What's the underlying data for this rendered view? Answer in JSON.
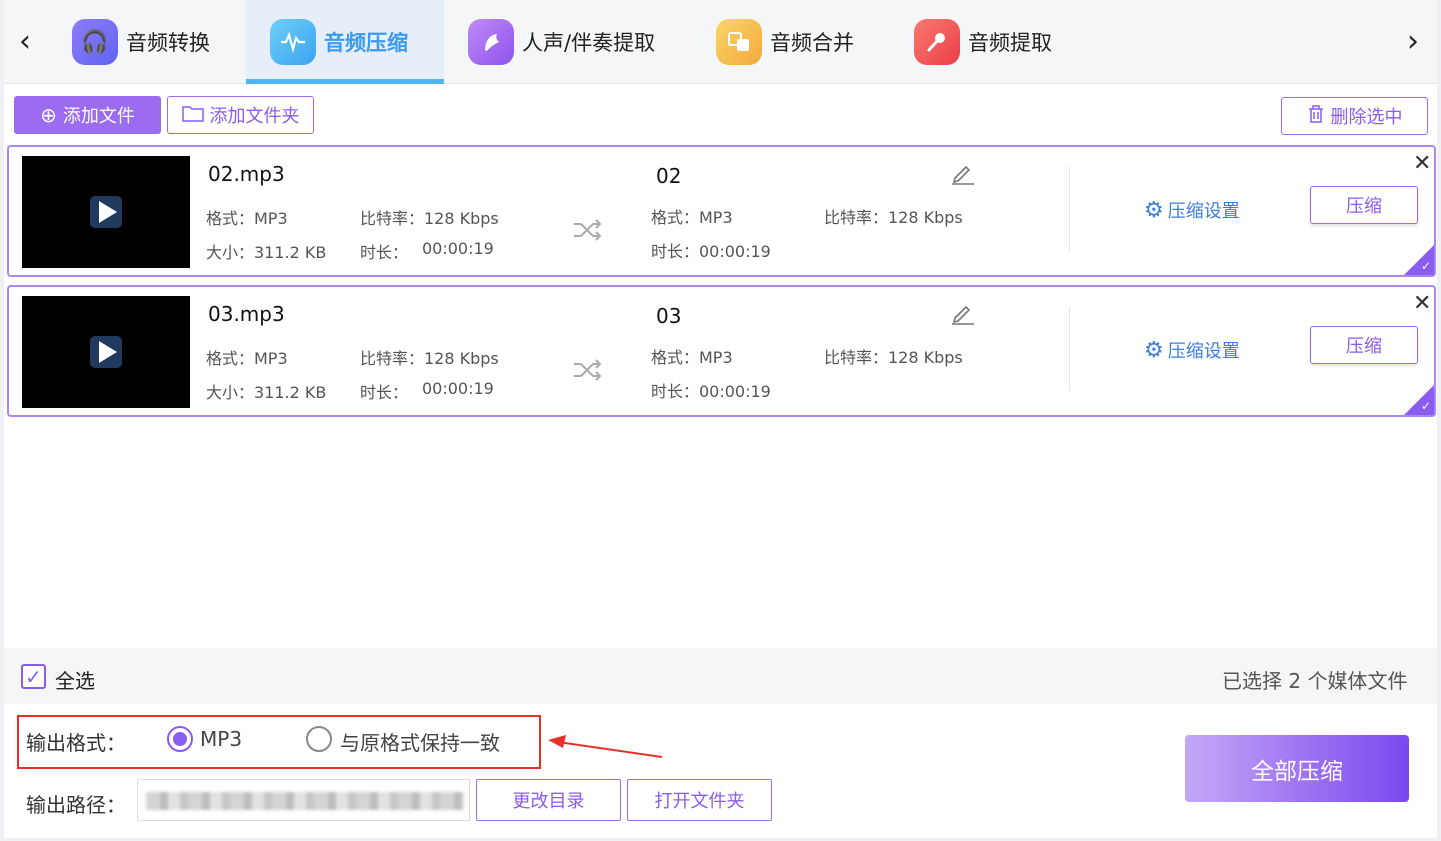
{
  "tabs": [
    {
      "label": "音频转换",
      "icon": "headphones-icon",
      "color": "#7b6cf6"
    },
    {
      "label": "音频压缩",
      "icon": "waveform-icon",
      "color": "#4eb5f4"
    },
    {
      "label": "人声/伴奏提取",
      "icon": "voice-icon",
      "color": "#a86cf2"
    },
    {
      "label": "音频合并",
      "icon": "merge-icon",
      "color": "#f5b740"
    },
    {
      "label": "音频提取",
      "icon": "microphone-icon",
      "color": "#f0484e"
    }
  ],
  "toolbar": {
    "add_file": "添加文件",
    "add_folder": "添加文件夹",
    "delete_selected": "删除选中"
  },
  "files": [
    {
      "name": "02.mp3",
      "format": "格式：MP3",
      "bitrate": "比特率：128 Kbps",
      "size": "大小：311.2 KB",
      "duration_label": "时长：",
      "duration": "00:00:19",
      "out_name": "02",
      "out_format": "格式：MP3",
      "out_bitrate": "比特率：128 Kbps",
      "out_duration": "时长：00:00:19",
      "settings": "压缩设置",
      "compress": "压缩"
    },
    {
      "name": "03.mp3",
      "format": "格式：MP3",
      "bitrate": "比特率：128 Kbps",
      "size": "大小：311.2 KB",
      "duration_label": "时长：",
      "duration": "00:00:19",
      "out_name": "03",
      "out_format": "格式：MP3",
      "out_bitrate": "比特率：128 Kbps",
      "out_duration": "时长：00:00:19",
      "settings": "压缩设置",
      "compress": "压缩"
    }
  ],
  "bottom": {
    "select_all": "全选",
    "selected_count": "已选择 2 个媒体文件",
    "output_format_label": "输出格式：",
    "format_option_mp3": "MP3",
    "format_option_keep": "与原格式保持一致",
    "output_path_label": "输出路径：",
    "change_dir": "更改目录",
    "open_folder": "打开文件夹",
    "compress_all": "全部压缩"
  },
  "colors": {
    "accent": "#8a5cf0",
    "active_tab": "#4eb5f4",
    "highlight_box": "#e8302a"
  }
}
